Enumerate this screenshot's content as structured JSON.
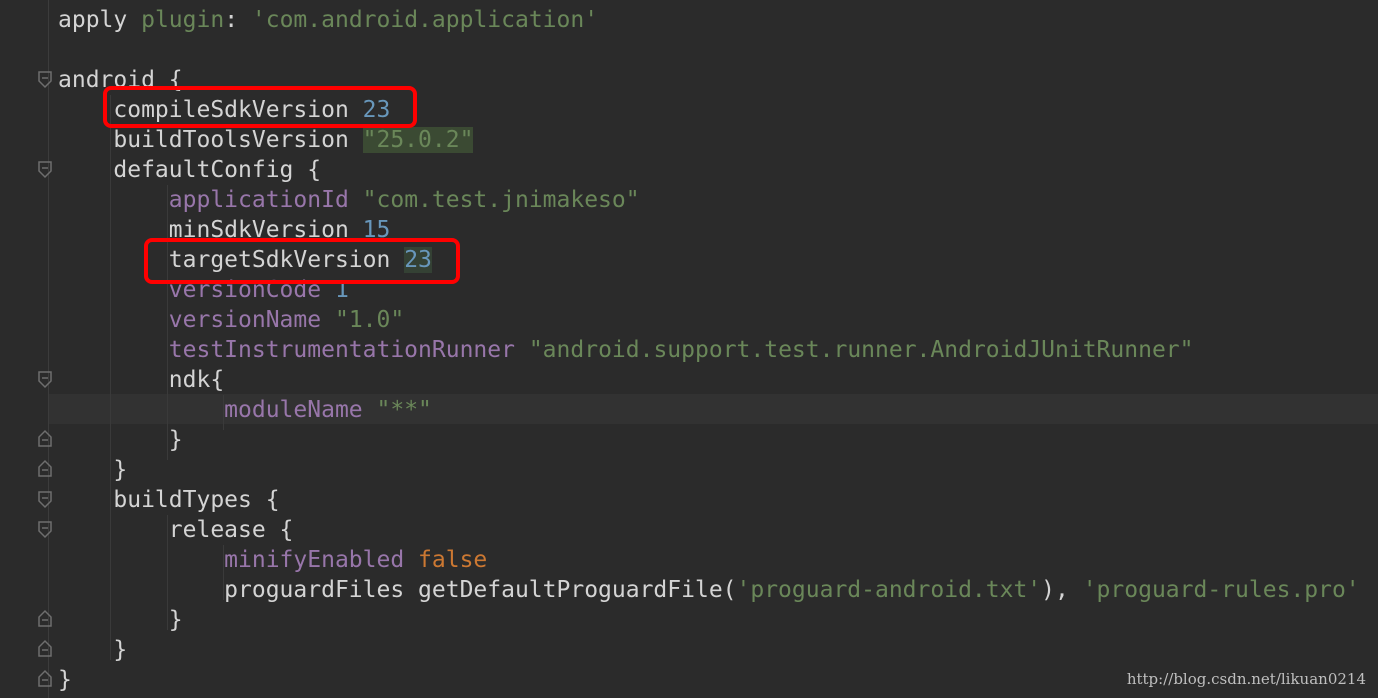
{
  "editor": {
    "language": "gradle",
    "colors": {
      "background": "#2b2b2b",
      "keyword": "#cc7832",
      "string": "#6a8759",
      "number": "#6897bb",
      "property": "#9876aa",
      "text": "#d4d4d4",
      "annotation_box": "#ff0000"
    },
    "lines": {
      "l1": {
        "a": "apply ",
        "b": "plugin",
        "c": ": ",
        "d": "'com.android.application'"
      },
      "l3": {
        "a": "android {"
      },
      "l4": {
        "a": "    compileSdkVersion ",
        "b": "23"
      },
      "l5": {
        "a": "    buildToolsVersion ",
        "b": "\"25.0.2\""
      },
      "l6": {
        "a": "    defaultConfig {"
      },
      "l7": {
        "a": "        ",
        "b": "applicationId",
        "c": " ",
        "d": "\"com.test.jnimakeso\""
      },
      "l8": {
        "a": "        minSdkVersion ",
        "b": "15"
      },
      "l9": {
        "a": "        targetSdkVersion ",
        "b": "23"
      },
      "l10": {
        "a": "        ",
        "b": "versionCode",
        "c": " ",
        "d": "1"
      },
      "l11": {
        "a": "        ",
        "b": "versionName",
        "c": " ",
        "d": "\"1.0\""
      },
      "l12": {
        "a": "        ",
        "b": "testInstrumentationRunner",
        "c": " ",
        "d": "\"android.support.test.runner.AndroidJUnitRunner\""
      },
      "l13": {
        "a": "        ndk{"
      },
      "l14": {
        "a": "            ",
        "b": "moduleName",
        "c": " ",
        "d": "\"**\""
      },
      "l15": {
        "a": "        }"
      },
      "l16": {
        "a": "    }"
      },
      "l17": {
        "a": "    buildTypes {"
      },
      "l18": {
        "a": "        release {"
      },
      "l19": {
        "a": "            ",
        "b": "minifyEnabled",
        "c": " ",
        "d": "false"
      },
      "l20": {
        "a": "            proguardFiles getDefaultProguardFile(",
        "b": "'proguard-android.txt'",
        "c": "), ",
        "d": "'proguard-rules.pro'"
      },
      "l21": {
        "a": "        }"
      },
      "l22": {
        "a": "    }"
      },
      "l23": {
        "a": "}"
      }
    },
    "highlights": [
      "compileSdkVersion 23",
      "targetSdkVersion 23"
    ]
  },
  "watermark": "http://blog.csdn.net/likuan0214"
}
